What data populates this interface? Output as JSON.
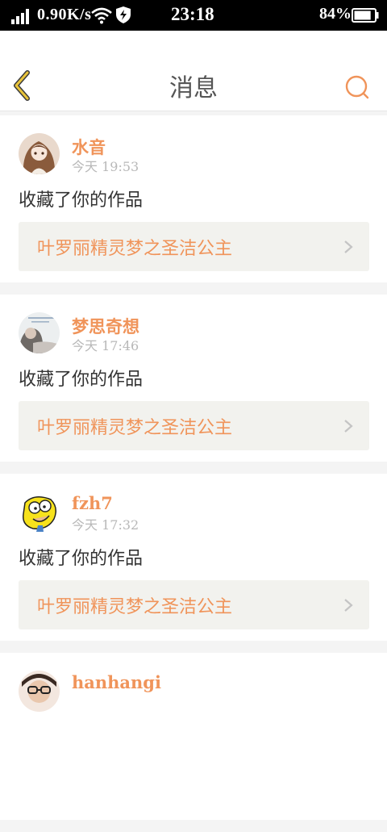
{
  "status_bar": {
    "speed": "0.90K/s",
    "time": "23:18",
    "battery_percent": "84%",
    "battery_level": 0.84,
    "icons": [
      "signal-icon",
      "wifi-icon",
      "shield-icon",
      "battery-icon"
    ]
  },
  "header": {
    "title": "消息",
    "back_icon": "chevron-left-icon",
    "search_icon": "search-icon"
  },
  "colors": {
    "accent": "#f0945a",
    "back_arrow": "#e8c33a",
    "card_link_bg": "#f2f2ee"
  },
  "messages": [
    {
      "username": "水音",
      "time": "今天 19:53",
      "action": "收藏了你的作品",
      "work_title": "叶罗丽精灵梦之圣洁公主"
    },
    {
      "username": "梦思奇想",
      "time": "今天 17:46",
      "action": "收藏了你的作品",
      "work_title": "叶罗丽精灵梦之圣洁公主"
    },
    {
      "username": "fzh7",
      "time": "今天 17:32",
      "action": "收藏了你的作品",
      "work_title": "叶罗丽精灵梦之圣洁公主"
    },
    {
      "username": "hanhangi",
      "time": "",
      "action": "",
      "work_title": ""
    }
  ]
}
